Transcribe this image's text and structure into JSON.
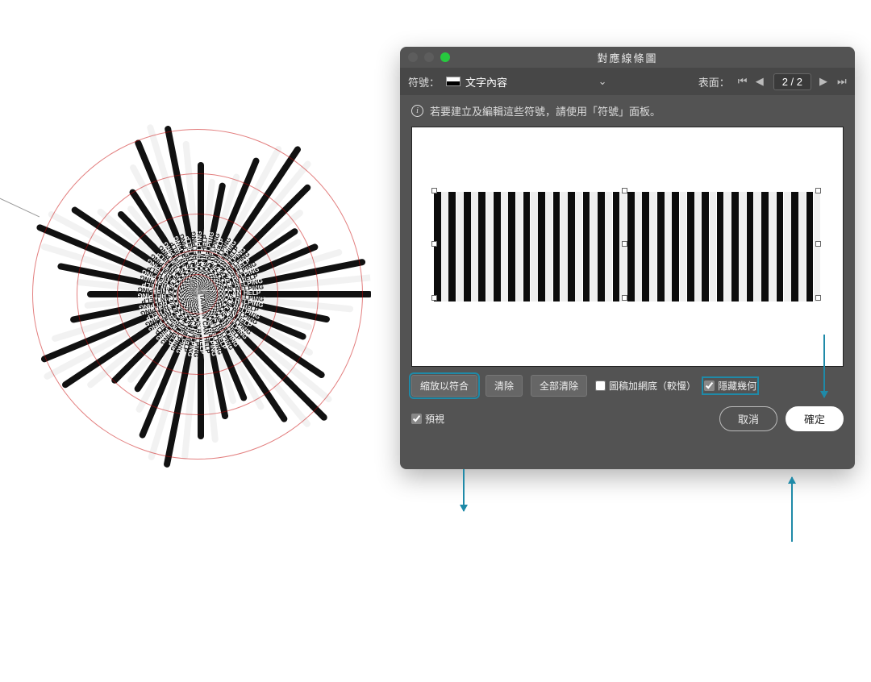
{
  "artwork": {
    "repeat_text": "TAIWAN IS HELPING",
    "secondary_text": "TAIWAN CAN HELP"
  },
  "dialog": {
    "title": "對應線條圖",
    "symbol_label": "符號：",
    "symbol_value": "文字內容",
    "surface_label": "表面：",
    "page_current": "2",
    "page_total": "2",
    "page_display": "2 / 2",
    "info": "若要建立及編輯這些符號，請使用「符號」面板。",
    "buttons": {
      "scale_to_fit": "縮放以符合",
      "clear": "清除",
      "clear_all": "全部清除"
    },
    "checkboxes": {
      "draft_label": "圖稿加網底（較慢）",
      "draft_checked": false,
      "hide_geometry_label": "隱藏幾何",
      "hide_geometry_checked": true
    },
    "preview_label": "預視",
    "preview_checked": true,
    "cancel": "取消",
    "ok": "確定"
  }
}
